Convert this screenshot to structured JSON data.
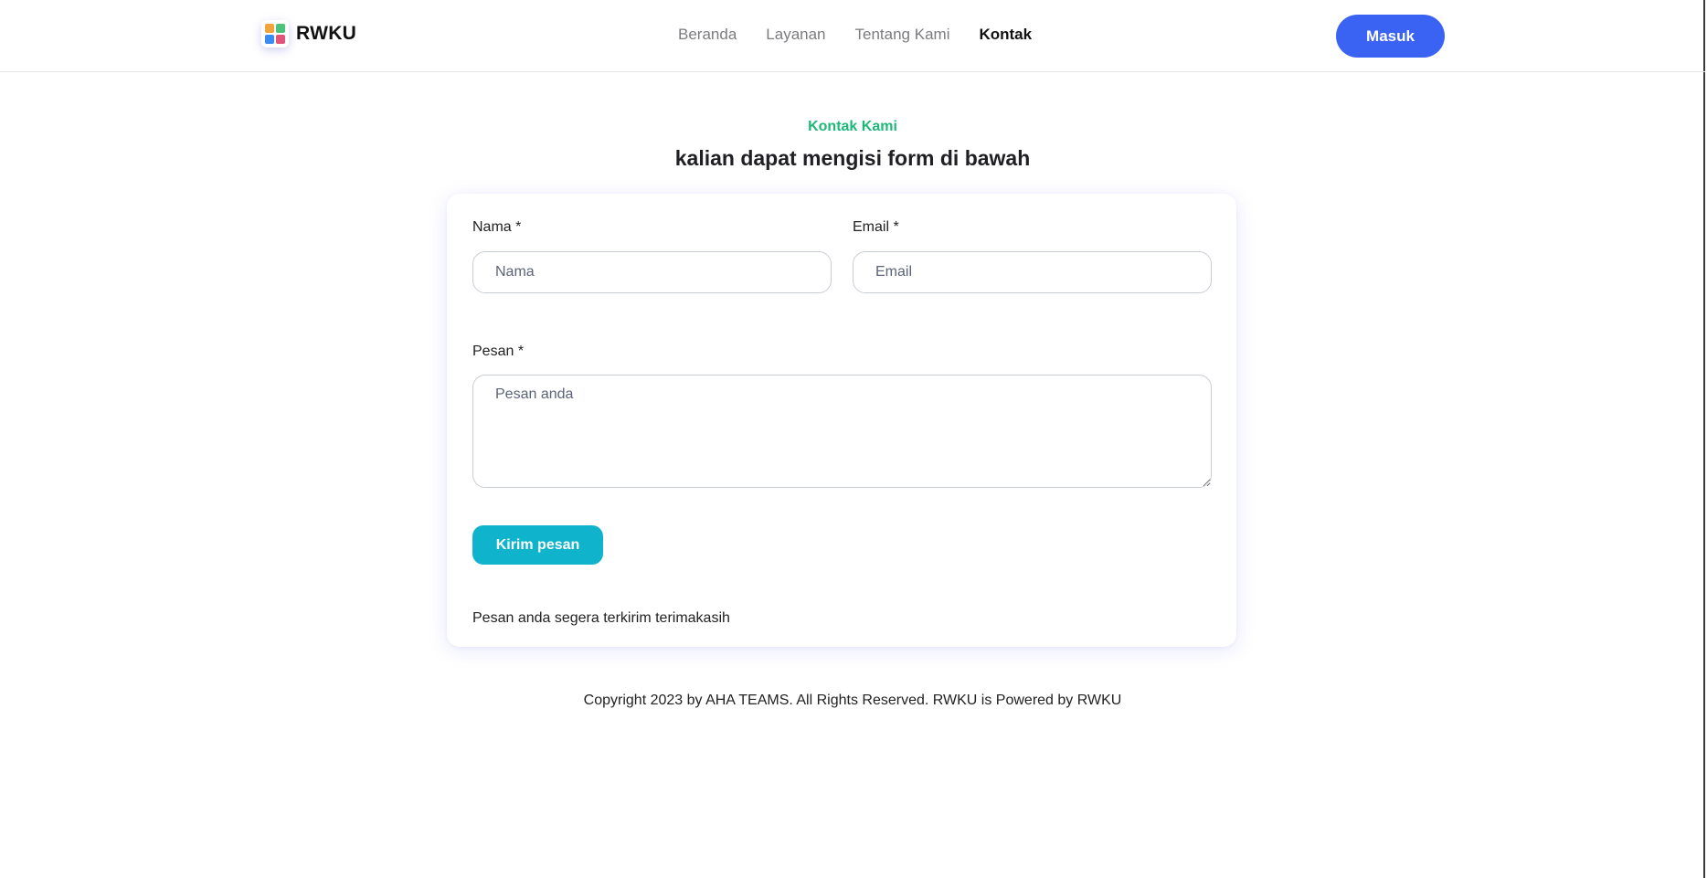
{
  "header": {
    "brand_name": "RWKU",
    "logo_colors": [
      "#f2a33a",
      "#4cc27a",
      "#3b8cf0",
      "#e2557a"
    ],
    "nav": [
      {
        "label": "Beranda",
        "active": false
      },
      {
        "label": "Layanan",
        "active": false
      },
      {
        "label": "Tentang Kami",
        "active": false
      },
      {
        "label": "Kontak",
        "active": true
      }
    ],
    "login_label": "Masuk"
  },
  "section": {
    "eyebrow": "Kontak Kami",
    "title": "kalian dapat mengisi form di bawah"
  },
  "form": {
    "name_label": "Nama *",
    "name_placeholder": "Nama",
    "email_label": "Email *",
    "email_placeholder": "Email",
    "message_label": "Pesan *",
    "message_placeholder": "Pesan anda",
    "submit_label": "Kirim pesan",
    "success_text": "Pesan anda segera terkirim terimakasih"
  },
  "footer": {
    "copyright": "Copyright 2023 by AHA TEAMS. All Rights Reserved. RWKU is Powered by RWKU"
  },
  "colors": {
    "accent_green": "#1db877",
    "primary_blue": "#3b63f3",
    "submit_teal": "#0fb4cc"
  }
}
